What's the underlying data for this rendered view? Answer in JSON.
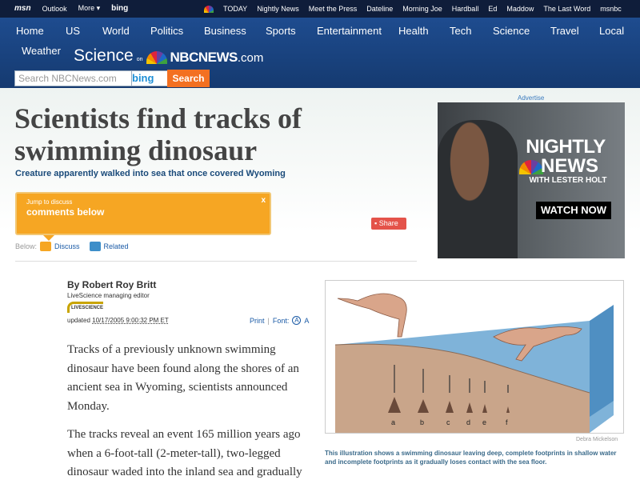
{
  "topbar": {
    "msn": "msn",
    "links": [
      "Outlook",
      "More"
    ],
    "more_arrow": "▾",
    "bing": "bing",
    "network": [
      "TODAY",
      "Nightly News",
      "Meet the Press",
      "Dateline",
      "Morning Joe",
      "Hardball",
      "Ed",
      "Maddow",
      "The Last Word",
      "msnbc"
    ]
  },
  "nav": {
    "items": [
      "Home",
      "US",
      "World",
      "Politics",
      "Business",
      "Sports",
      "Entertainment",
      "Health",
      "Tech",
      "Science",
      "Travel",
      "Local",
      "Weather"
    ]
  },
  "brand": {
    "section": "Science",
    "on": "on",
    "nbcnews": "NBCNEWS",
    "com": ".com"
  },
  "search": {
    "placeholder": "Search NBCNews.com",
    "bing": "bing",
    "button": "Search"
  },
  "article": {
    "headline": "Scientists find tracks of swimming dinosaur",
    "subhead": "Creature apparently walked into sea that once covered Wyoming",
    "jump_text": "Jump to discuss",
    "comments_label": "comments below",
    "close": "x",
    "share": "Share",
    "below_label": "Below:",
    "discuss": "Discuss",
    "related": "Related",
    "byline": "By Robert Roy Britt",
    "role": "LiveScience managing editor",
    "source_logo": "LIVESCIENCE",
    "updated_label": "updated",
    "updated_date": "10/17/2005 9:00:32 PM ET",
    "print": "Print",
    "font_label": "Font:",
    "font_small": "A",
    "font_large": "A",
    "paragraphs": [
      "Tracks of a previously unknown swimming dinosaur have been found along the shores of an ancient sea in Wyoming, scientists announced Monday.",
      "The tracks reveal an event 165 million years ago when a 6-foot-tall (2-meter-tall), two-legged dinosaur waded into the inland sea and gradually"
    ]
  },
  "ad": {
    "label": "Advertise",
    "line1": "NIGHTLY",
    "line2": "NEWS",
    "line3": "WITH LESTER HOLT",
    "cta": "WATCH NOW"
  },
  "illustration": {
    "footprint_labels": [
      "a",
      "b",
      "c",
      "d",
      "e",
      "f"
    ],
    "credit": "Debra Mickelson",
    "caption": "This illustration shows a swimming dinosaur leaving deep, complete footprints in shallow water and incomplete footprints as it gradually loses contact with the sea floor."
  }
}
